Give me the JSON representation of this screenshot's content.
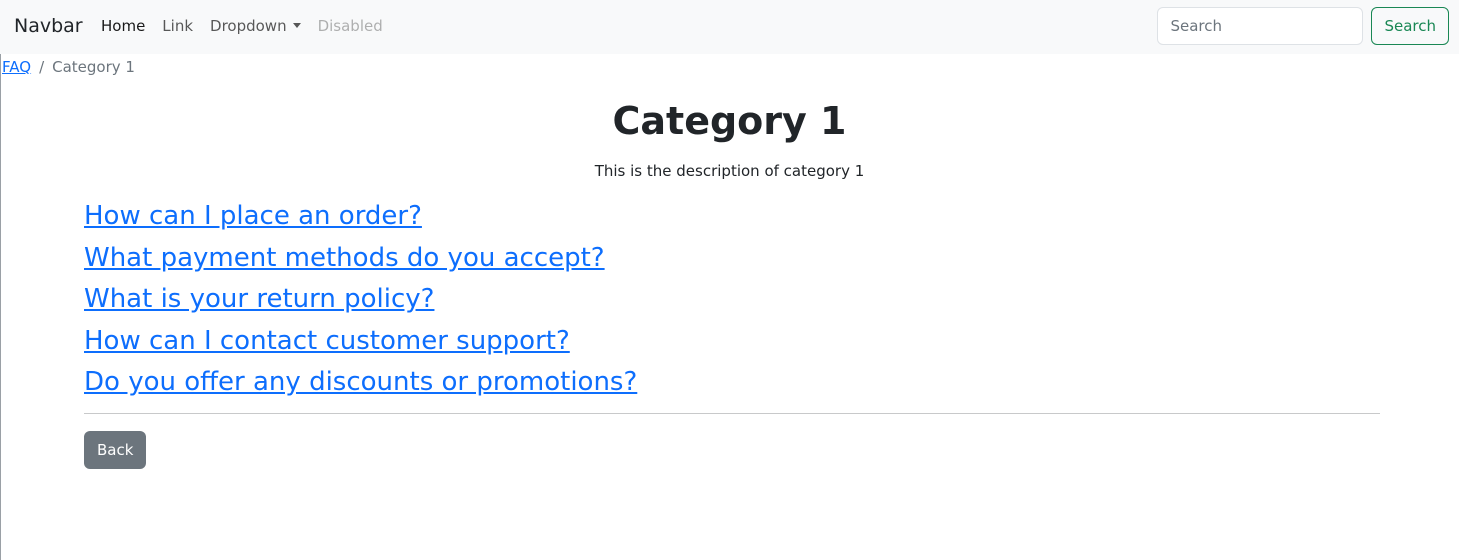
{
  "navbar": {
    "brand": "Navbar",
    "links": [
      {
        "label": "Home",
        "state": "active"
      },
      {
        "label": "Link",
        "state": "normal"
      },
      {
        "label": "Dropdown",
        "state": "normal"
      },
      {
        "label": "Disabled",
        "state": "disabled"
      }
    ],
    "search": {
      "placeholder": "Search",
      "value": "",
      "button_label": "Search"
    }
  },
  "breadcrumb": {
    "root": "FAQ",
    "separator": "/",
    "current": "Category 1"
  },
  "main": {
    "title": "Category 1",
    "description": "This is the description of category 1",
    "questions": [
      "How can I place an order?",
      "What payment methods do you accept?",
      "What is your return policy?",
      "How can I contact customer support?",
      "Do you offer any discounts or promotions?"
    ],
    "back_label": "Back"
  },
  "colors": {
    "link": "#0d6efd",
    "success": "#198754",
    "secondary": "#6c757d",
    "navbar_bg": "#f8f9fa"
  }
}
